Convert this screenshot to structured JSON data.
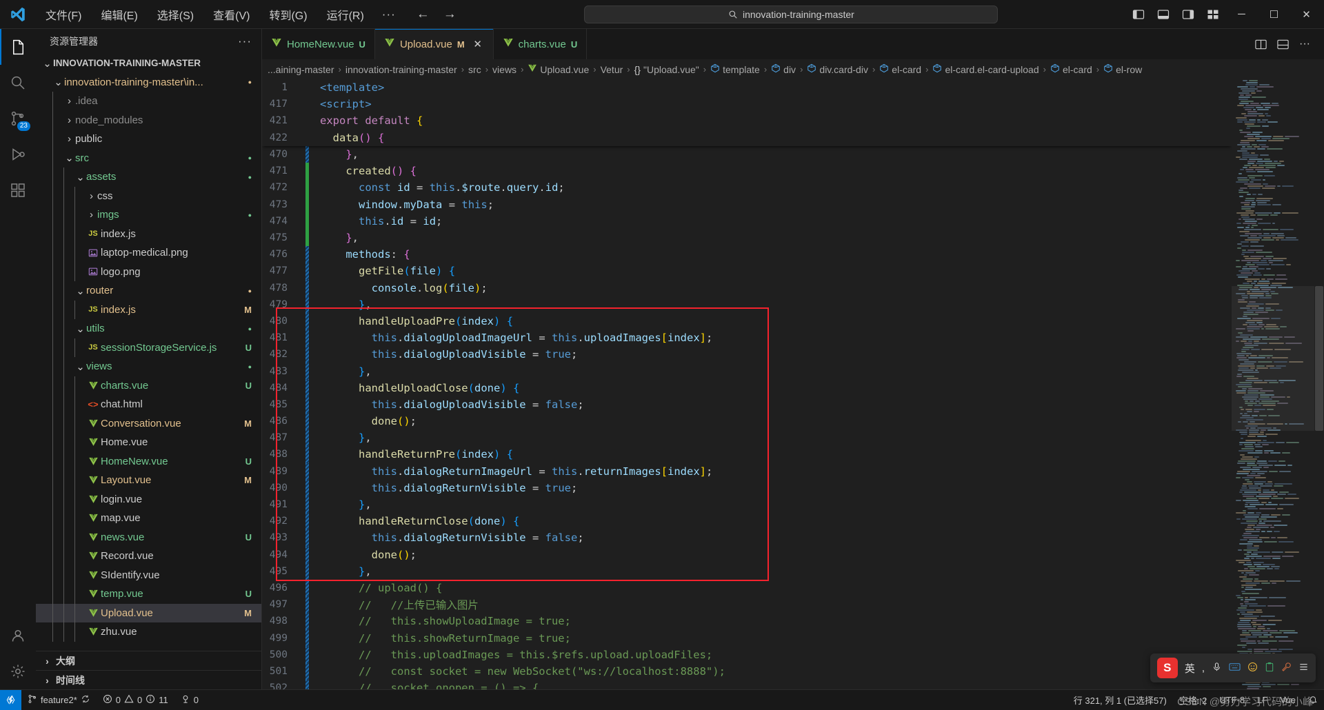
{
  "titlebar": {
    "menu_items": [
      "文件(F)",
      "编辑(E)",
      "选择(S)",
      "查看(V)",
      "转到(G)",
      "运行(R)"
    ],
    "more_label": "···",
    "back_icon": "arrow-left-icon",
    "forward_icon": "arrow-right-icon",
    "search_value": "innovation-training-master",
    "search_icon": "search-icon",
    "layout_icons": [
      "toggle-primary-sidebar-icon",
      "toggle-panel-icon",
      "toggle-secondary-sidebar-icon",
      "customize-layout-icon"
    ],
    "window_minimize": "─",
    "window_maximize": "☐",
    "window_close": "✕"
  },
  "activitybar": {
    "items": [
      {
        "name": "explorer",
        "icon": "files-icon",
        "active": true,
        "badge": ""
      },
      {
        "name": "search",
        "icon": "search-icon",
        "active": false,
        "badge": ""
      },
      {
        "name": "source-control",
        "icon": "source-control-icon",
        "active": false,
        "badge": "23"
      },
      {
        "name": "run-debug",
        "icon": "debug-icon",
        "active": false,
        "badge": ""
      },
      {
        "name": "extensions",
        "icon": "extensions-icon",
        "active": false,
        "badge": ""
      }
    ],
    "bottom": [
      {
        "name": "accounts",
        "icon": "account-icon"
      },
      {
        "name": "settings",
        "icon": "gear-icon"
      }
    ]
  },
  "sidebar": {
    "title": "资源管理器",
    "actions_icon": "more-actions-icon",
    "tree": [
      {
        "label": "INNOVATION-TRAINING-MASTER",
        "depth": 0,
        "type": "root",
        "twisty": "down",
        "color": "#cccccc",
        "badge": "",
        "bold": true
      },
      {
        "label": "innovation-training-master\\in...",
        "depth": 1,
        "type": "folder",
        "twisty": "down",
        "color": "#e2c08d",
        "badge": "",
        "dot": "#e2c08d"
      },
      {
        "label": ".idea",
        "depth": 2,
        "type": "folder",
        "twisty": "right",
        "color": "#8c8c8c",
        "badge": ""
      },
      {
        "label": "node_modules",
        "depth": 2,
        "type": "folder",
        "twisty": "right",
        "color": "#8c8c8c",
        "badge": ""
      },
      {
        "label": "public",
        "depth": 2,
        "type": "folder",
        "twisty": "right",
        "color": "#cccccc",
        "badge": ""
      },
      {
        "label": "src",
        "depth": 2,
        "type": "folder",
        "twisty": "down",
        "color": "#73c991",
        "badge": "",
        "dot": "#73c991"
      },
      {
        "label": "assets",
        "depth": 3,
        "type": "folder",
        "twisty": "down",
        "color": "#73c991",
        "badge": "",
        "dot": "#73c991"
      },
      {
        "label": "css",
        "depth": 4,
        "type": "folder",
        "twisty": "right",
        "color": "#cccccc",
        "badge": ""
      },
      {
        "label": "imgs",
        "depth": 4,
        "type": "folder",
        "twisty": "right",
        "color": "#73c991",
        "badge": "",
        "dot": "#73c991"
      },
      {
        "label": "index.js",
        "depth": 4,
        "type": "js",
        "twisty": "",
        "color": "#cccccc",
        "badge": ""
      },
      {
        "label": "laptop-medical.png",
        "depth": 4,
        "type": "img",
        "twisty": "",
        "color": "#cccccc",
        "badge": ""
      },
      {
        "label": "logo.png",
        "depth": 4,
        "type": "img",
        "twisty": "",
        "color": "#cccccc",
        "badge": ""
      },
      {
        "label": "router",
        "depth": 3,
        "type": "folder",
        "twisty": "down",
        "color": "#e2c08d",
        "badge": "",
        "dot": "#e2c08d"
      },
      {
        "label": "index.js",
        "depth": 4,
        "type": "js",
        "twisty": "",
        "color": "#e2c08d",
        "badge": "M"
      },
      {
        "label": "utils",
        "depth": 3,
        "type": "folder",
        "twisty": "down",
        "color": "#73c991",
        "badge": "",
        "dot": "#73c991"
      },
      {
        "label": "sessionStorageService.js",
        "depth": 4,
        "type": "js",
        "twisty": "",
        "color": "#73c991",
        "badge": "U"
      },
      {
        "label": "views",
        "depth": 3,
        "type": "folder",
        "twisty": "down",
        "color": "#73c991",
        "badge": "",
        "dot": "#73c991"
      },
      {
        "label": "charts.vue",
        "depth": 4,
        "type": "vue",
        "twisty": "",
        "color": "#73c991",
        "badge": "U"
      },
      {
        "label": "chat.html",
        "depth": 4,
        "type": "html",
        "twisty": "",
        "color": "#cccccc",
        "badge": ""
      },
      {
        "label": "Conversation.vue",
        "depth": 4,
        "type": "vue",
        "twisty": "",
        "color": "#e2c08d",
        "badge": "M"
      },
      {
        "label": "Home.vue",
        "depth": 4,
        "type": "vue",
        "twisty": "",
        "color": "#cccccc",
        "badge": ""
      },
      {
        "label": "HomeNew.vue",
        "depth": 4,
        "type": "vue",
        "twisty": "",
        "color": "#73c991",
        "badge": "U"
      },
      {
        "label": "Layout.vue",
        "depth": 4,
        "type": "vue",
        "twisty": "",
        "color": "#e2c08d",
        "badge": "M"
      },
      {
        "label": "login.vue",
        "depth": 4,
        "type": "vue",
        "twisty": "",
        "color": "#cccccc",
        "badge": ""
      },
      {
        "label": "map.vue",
        "depth": 4,
        "type": "vue",
        "twisty": "",
        "color": "#cccccc",
        "badge": ""
      },
      {
        "label": "news.vue",
        "depth": 4,
        "type": "vue",
        "twisty": "",
        "color": "#73c991",
        "badge": "U"
      },
      {
        "label": "Record.vue",
        "depth": 4,
        "type": "vue",
        "twisty": "",
        "color": "#cccccc",
        "badge": ""
      },
      {
        "label": "SIdentify.vue",
        "depth": 4,
        "type": "vue",
        "twisty": "",
        "color": "#cccccc",
        "badge": ""
      },
      {
        "label": "temp.vue",
        "depth": 4,
        "type": "vue",
        "twisty": "",
        "color": "#73c991",
        "badge": "U"
      },
      {
        "label": "Upload.vue",
        "depth": 4,
        "type": "vue",
        "twisty": "",
        "color": "#e2c08d",
        "badge": "M",
        "selected": true
      },
      {
        "label": "zhu.vue",
        "depth": 4,
        "type": "vue",
        "twisty": "",
        "color": "#cccccc",
        "badge": ""
      }
    ],
    "sections": [
      {
        "label": "大纲",
        "twisty": "right"
      },
      {
        "label": "时间线",
        "twisty": "right"
      }
    ]
  },
  "tabs": {
    "items": [
      {
        "label": "HomeNew.vue",
        "badge": "U",
        "badge_color": "#73c991",
        "color": "#73c991",
        "active": false,
        "closable": false
      },
      {
        "label": "Upload.vue",
        "badge": "M",
        "badge_color": "#e2c08d",
        "color": "#e2c08d",
        "active": true,
        "closable": true,
        "close_icon": "close-icon"
      },
      {
        "label": "charts.vue",
        "badge": "U",
        "badge_color": "#73c991",
        "color": "#73c991",
        "active": false,
        "closable": false
      }
    ],
    "actions": [
      "split-editor-icon",
      "layout-editor-icon",
      "more-actions-icon"
    ]
  },
  "breadcrumb": {
    "items": [
      {
        "label": "...aining-master",
        "icon": ""
      },
      {
        "label": "innovation-training-master",
        "icon": ""
      },
      {
        "label": "src",
        "icon": ""
      },
      {
        "label": "views",
        "icon": ""
      },
      {
        "label": "Upload.vue",
        "icon": "vue-icon"
      },
      {
        "label": "Vetur",
        "icon": ""
      },
      {
        "label": "\"Upload.vue\"",
        "icon": "braces-icon"
      },
      {
        "label": "template",
        "icon": "symbol-icon"
      },
      {
        "label": "div",
        "icon": "symbol-icon"
      },
      {
        "label": "div.card-div",
        "icon": "symbol-icon"
      },
      {
        "label": "el-card",
        "icon": "symbol-icon"
      },
      {
        "label": "el-card.el-card-upload",
        "icon": "symbol-icon"
      },
      {
        "label": "el-card",
        "icon": "symbol-icon"
      },
      {
        "label": "el-row",
        "icon": "symbol-icon"
      }
    ],
    "separator": "›"
  },
  "code": {
    "sticky_lines": [
      {
        "num": "1",
        "html": "<span class='tag'>&lt;template&gt;</span>"
      },
      {
        "num": "417",
        "html": "<span class='tag'>&lt;script&gt;</span>"
      },
      {
        "num": "421",
        "html": "<span class='kw'>export</span> <span class='kw'>default</span> <span class='brace-y'>{</span>"
      },
      {
        "num": "422",
        "html": "  <span class='fn'>data</span><span class='brace-p'>()</span> <span class='brace-p'>{</span>"
      }
    ],
    "lines": [
      {
        "num": "470",
        "gutter": "blue",
        "indent": 1,
        "html": "    <span class='brace-p'>}</span><span class='punc'>,</span>"
      },
      {
        "num": "471",
        "gutter": "green",
        "indent": 1,
        "html": "    <span class='fn'>created</span><span class='brace-p'>()</span> <span class='brace-p'>{</span>"
      },
      {
        "num": "472",
        "gutter": "green",
        "indent": 2,
        "html": "      <span class='kw2'>const</span> <span class='var'>id</span> <span class='punc'>=</span> <span class='this'>this</span><span class='punc'>.</span><span class='prop'>$route</span><span class='punc'>.</span><span class='prop'>query</span><span class='punc'>.</span><span class='prop'>id</span><span class='punc'>;</span>"
      },
      {
        "num": "473",
        "gutter": "green",
        "indent": 2,
        "html": "      <span class='var'>window</span><span class='punc'>.</span><span class='prop'>myData</span> <span class='punc'>=</span> <span class='this'>this</span><span class='punc'>;</span>"
      },
      {
        "num": "474",
        "gutter": "green",
        "indent": 2,
        "html": "      <span class='this'>this</span><span class='punc'>.</span><span class='prop'>id</span> <span class='punc'>=</span> <span class='var'>id</span><span class='punc'>;</span>"
      },
      {
        "num": "475",
        "gutter": "green",
        "indent": 1,
        "html": "    <span class='brace-p'>}</span><span class='punc'>,</span>"
      },
      {
        "num": "476",
        "gutter": "blue",
        "indent": 1,
        "html": "    <span class='var'>methods</span><span class='punc'>:</span> <span class='brace-p'>{</span>"
      },
      {
        "num": "477",
        "gutter": "blue",
        "indent": 2,
        "html": "      <span class='fn'>getFile</span><span class='brace-b'>(</span><span class='var'>file</span><span class='brace-b'>)</span> <span class='brace-b'>{</span>"
      },
      {
        "num": "478",
        "gutter": "blue",
        "indent": 3,
        "html": "        <span class='var'>console</span><span class='punc'>.</span><span class='fn'>log</span><span class='brace-y'>(</span><span class='var'>file</span><span class='brace-y'>)</span><span class='punc'>;</span>"
      },
      {
        "num": "479",
        "gutter": "blue",
        "indent": 2,
        "html": "      <span class='brace-b'>}</span><span class='punc'>,</span>"
      },
      {
        "num": "480",
        "gutter": "blue",
        "indent": 2,
        "html": "      <span class='fn'>handleUploadPre</span><span class='brace-b'>(</span><span class='var'>index</span><span class='brace-b'>)</span> <span class='brace-b'>{</span>"
      },
      {
        "num": "481",
        "gutter": "blue",
        "indent": 3,
        "html": "        <span class='this'>this</span><span class='punc'>.</span><span class='prop'>dialogUploadImageUrl</span> <span class='punc'>=</span> <span class='this'>this</span><span class='punc'>.</span><span class='prop'>uploadImages</span><span class='brace-y'>[</span><span class='var'>index</span><span class='brace-y'>]</span><span class='punc'>;</span>"
      },
      {
        "num": "482",
        "gutter": "blue",
        "indent": 3,
        "html": "        <span class='this'>this</span><span class='punc'>.</span><span class='prop'>dialogUploadVisible</span> <span class='punc'>=</span> <span class='kw2'>true</span><span class='punc'>;</span>"
      },
      {
        "num": "483",
        "gutter": "blue",
        "indent": 2,
        "html": "      <span class='brace-b'>}</span><span class='punc'>,</span>"
      },
      {
        "num": "484",
        "gutter": "blue",
        "indent": 2,
        "html": "      <span class='fn'>handleUploadClose</span><span class='brace-b'>(</span><span class='var'>done</span><span class='brace-b'>)</span> <span class='brace-b'>{</span>"
      },
      {
        "num": "485",
        "gutter": "blue",
        "indent": 3,
        "html": "        <span class='this'>this</span><span class='punc'>.</span><span class='prop'>dialogUploadVisible</span> <span class='punc'>=</span> <span class='kw2'>false</span><span class='punc'>;</span>"
      },
      {
        "num": "486",
        "gutter": "blue",
        "indent": 3,
        "html": "        <span class='fn'>done</span><span class='brace-y'>()</span><span class='punc'>;</span>"
      },
      {
        "num": "487",
        "gutter": "blue",
        "indent": 2,
        "html": "      <span class='brace-b'>}</span><span class='punc'>,</span>"
      },
      {
        "num": "488",
        "gutter": "blue",
        "indent": 2,
        "html": "      <span class='fn'>handleReturnPre</span><span class='brace-b'>(</span><span class='var'>index</span><span class='brace-b'>)</span> <span class='brace-b'>{</span>"
      },
      {
        "num": "489",
        "gutter": "blue",
        "indent": 3,
        "html": "        <span class='this'>this</span><span class='punc'>.</span><span class='prop'>dialogReturnImageUrl</span> <span class='punc'>=</span> <span class='this'>this</span><span class='punc'>.</span><span class='prop'>returnImages</span><span class='brace-y'>[</span><span class='var'>index</span><span class='brace-y'>]</span><span class='punc'>;</span>"
      },
      {
        "num": "490",
        "gutter": "blue",
        "indent": 3,
        "html": "        <span class='this'>this</span><span class='punc'>.</span><span class='prop'>dialogReturnVisible</span> <span class='punc'>=</span> <span class='kw2'>true</span><span class='punc'>;</span>"
      },
      {
        "num": "491",
        "gutter": "blue",
        "indent": 2,
        "html": "      <span class='brace-b'>}</span><span class='punc'>,</span>"
      },
      {
        "num": "492",
        "gutter": "blue",
        "indent": 2,
        "html": "      <span class='fn'>handleReturnClose</span><span class='brace-b'>(</span><span class='var'>done</span><span class='brace-b'>)</span> <span class='brace-b'>{</span>"
      },
      {
        "num": "493",
        "gutter": "blue",
        "indent": 3,
        "html": "        <span class='this'>this</span><span class='punc'>.</span><span class='prop'>dialogReturnVisible</span> <span class='punc'>=</span> <span class='kw2'>false</span><span class='punc'>;</span>"
      },
      {
        "num": "494",
        "gutter": "blue",
        "indent": 3,
        "html": "        <span class='fn'>done</span><span class='brace-y'>()</span><span class='punc'>;</span>"
      },
      {
        "num": "495",
        "gutter": "blue",
        "indent": 2,
        "html": "      <span class='brace-b'>}</span><span class='punc'>,</span>"
      },
      {
        "num": "496",
        "gutter": "blue",
        "indent": 2,
        "html": "      <span class='cmt'>// upload() {</span>"
      },
      {
        "num": "497",
        "gutter": "blue",
        "indent": 2,
        "html": "      <span class='cmt'>//   //上传已输入图片</span>"
      },
      {
        "num": "498",
        "gutter": "blue",
        "indent": 2,
        "html": "      <span class='cmt'>//   this.showUploadImage = true;</span>"
      },
      {
        "num": "499",
        "gutter": "blue",
        "indent": 2,
        "html": "      <span class='cmt'>//   this.showReturnImage = true;</span>"
      },
      {
        "num": "500",
        "gutter": "blue",
        "indent": 2,
        "html": "      <span class='cmt'>//   this.uploadImages = this.$refs.upload.uploadFiles;</span>"
      },
      {
        "num": "501",
        "gutter": "blue",
        "indent": 2,
        "html": "      <span class='cmt'>//   const socket = new WebSocket(\"ws://localhost:8888\");</span>"
      },
      {
        "num": "502",
        "gutter": "blue",
        "indent": 2,
        "html": "      <span class='cmt'>//   socket.onopen = () => {</span>"
      }
    ],
    "annotation": {
      "color": "#f5222d",
      "label": "highlight-rectangle"
    }
  },
  "statusbar": {
    "remote_icon": "remote-window-icon",
    "branch_icon": "source-control-icon",
    "branch": "feature2*",
    "sync_icon": "sync-icon",
    "error_icon": "error-icon",
    "errors": "0",
    "warning_icon": "warning-icon",
    "warnings": "0",
    "info_icon": "info-icon",
    "infos": "11",
    "ports_icon": "ports-icon",
    "ports": "0",
    "cursor": "行 321, 列 1 (已选择57)",
    "indent": "空格: 2",
    "encoding": "UTF-8",
    "eol": "LF",
    "language": "Vue",
    "bell_icon": "bell-icon",
    "feedback_icon": "feedback-icon"
  },
  "ime": {
    "logo": "S",
    "mode": "英",
    "icons": [
      "comma-icon",
      "mic-icon",
      "keyboard-icon",
      "emoji-icon",
      "clipboard-icon",
      "tools-icon",
      "menu-icon"
    ]
  },
  "watermark": "CSDN @努力学习代码的小峰"
}
